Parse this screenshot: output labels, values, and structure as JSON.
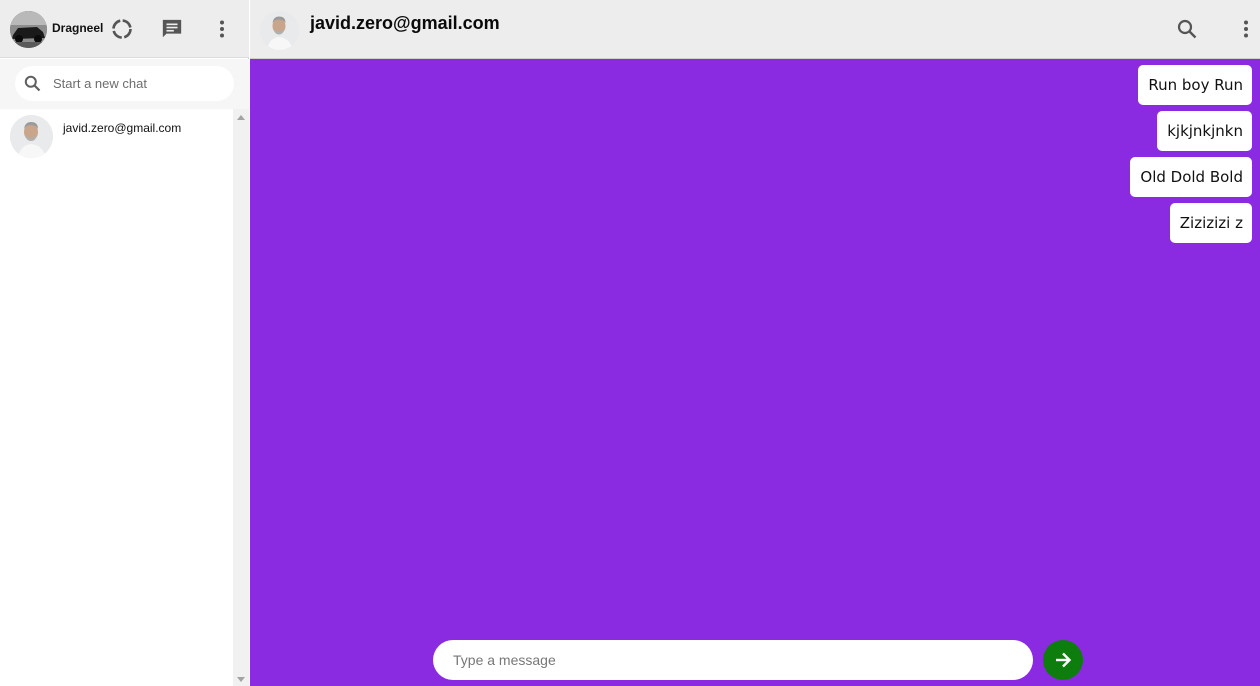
{
  "sidebar": {
    "user": {
      "name": "Dragneel",
      "avatar": "car-avatar"
    },
    "header_icons": [
      "status-icon",
      "new-chat-icon",
      "more-vert-icon"
    ],
    "search": {
      "placeholder": "Start a new chat",
      "icon": "search-icon"
    },
    "chats": [
      {
        "name": "javid.zero@gmail.com",
        "avatar": "person-avatar"
      }
    ]
  },
  "chat": {
    "contact": {
      "name": "javid.zero@gmail.com",
      "avatar": "person-avatar"
    },
    "header_icons": [
      "search-icon",
      "more-vert-icon"
    ],
    "messages": [
      {
        "text": "Run boy Run"
      },
      {
        "text": "kjkjnkjnkn"
      },
      {
        "text": "Old Dold Bold"
      },
      {
        "text": "Zizizizi z"
      }
    ],
    "compose": {
      "placeholder": "Type a message",
      "send_icon": "arrow-right-icon"
    }
  },
  "colors": {
    "chat_background": "#8a2be2",
    "header_background": "#ededed",
    "send_button": "#0d7d0d",
    "bubble": "#ffffff"
  }
}
